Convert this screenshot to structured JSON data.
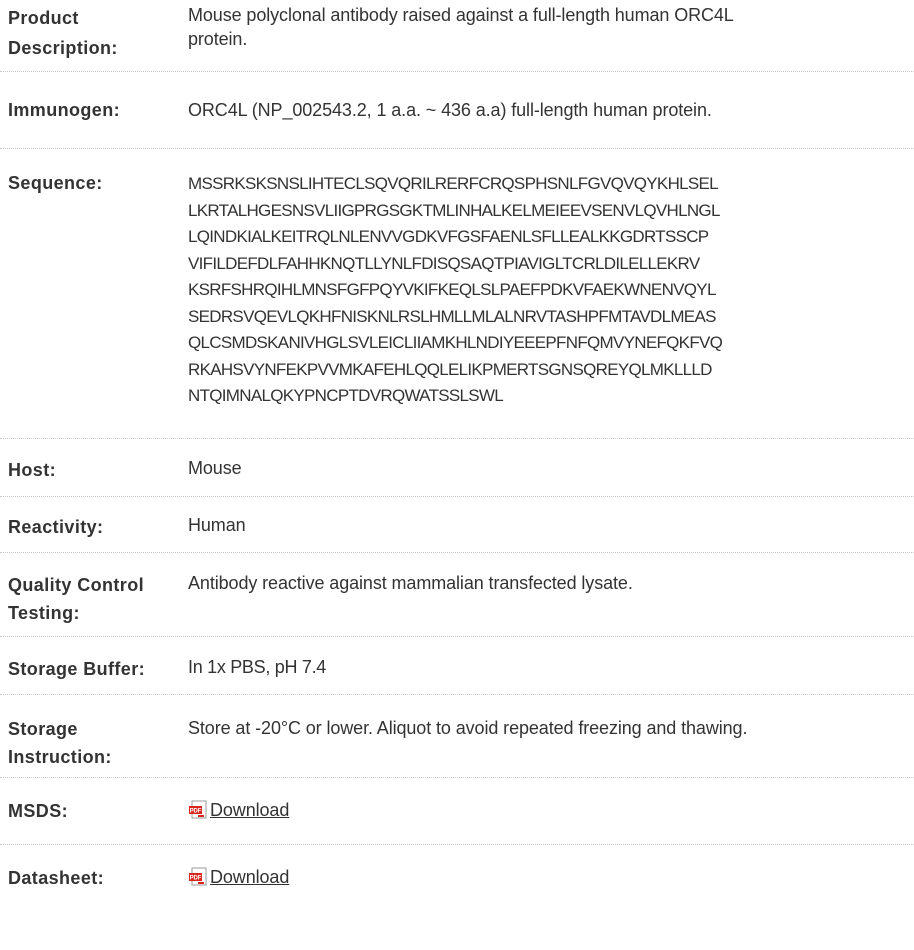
{
  "rows": {
    "product_description": {
      "label_line1": "Product",
      "label_line2": "Description:",
      "value_line1": "Mouse polyclonal antibody raised against a full-length human ORC4L",
      "value_line2": "protein."
    },
    "immunogen": {
      "label": "Immunogen:",
      "value": "ORC4L (NP_002543.2, 1 a.a. ~ 436 a.a) full-length human protein."
    },
    "sequence": {
      "label": "Sequence:",
      "lines": [
        "MSSRKSKSNSLIHTECLSQVQRILRERFCRQSPHSNLFGVQVQYKHLSEL",
        "LKRTALHGESNSVLIIGPRGSGKTMLINHALKELMEIEEVSENVLQVHLNGL",
        "LQINDKIALKEITRQLNLENVVGDKVFGSFAENLSFLLEALKKGDRTSSCP",
        "VIFILDEFDLFAHHKNQTLLYNLFDISQSAQTPIAVIGLTCRLDILELLEKRV",
        "KSRFSHRQIHLMNSFGFPQYVKIFKEQLSLPAEFPDKVFAEKWNENVQYL",
        "SEDRSVQEVLQKHFNISKNLRSLHMLLMLALNRVTASHPFMTAVDLMEAS",
        "QLCSMDSKANIVHGLSVLEICLIIAMKHLNDIYEEEPFNFQMVYNEFQKFVQ",
        "RKAHSVYNFEKPVVMKAFEHLQQLELIKPMERTSGNSQREYQLMKLLLD",
        "NTQIMNALQKYPNCPTDVRQWATSSLSWL"
      ]
    },
    "host": {
      "label": "Host:",
      "value": "Mouse"
    },
    "reactivity": {
      "label": "Reactivity:",
      "value": "Human"
    },
    "quality_control": {
      "label_line1": "Quality Control",
      "label_line2": "Testing:",
      "value": "Antibody reactive against mammalian transfected lysate."
    },
    "storage_buffer": {
      "label": "Storage Buffer:",
      "value": "In 1x PBS, pH 7.4"
    },
    "storage_instruction": {
      "label_line1": "Storage",
      "label_line2": "Instruction:",
      "value": "Store at -20°C or lower. Aliquot to avoid repeated freezing and thawing."
    },
    "msds": {
      "label": "MSDS:",
      "link_text": "Download",
      "icon": "pdf-icon"
    },
    "datasheet": {
      "label": "Datasheet:",
      "link_text": "Download",
      "icon": "pdf-icon"
    }
  },
  "colors": {
    "text": "#333333",
    "divider": "#c8c8c8",
    "pdf_red": "#d9261c"
  }
}
